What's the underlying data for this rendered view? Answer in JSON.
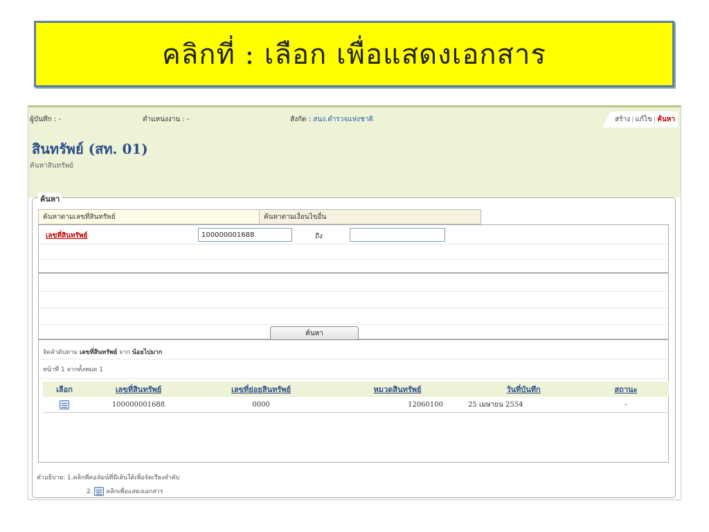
{
  "banner": {
    "text": "คลิกที่ : เลือก เพื่อแสดงเอกสาร"
  },
  "topbar": {
    "recorder": "ผู้บันทึก : -",
    "position": "ตำแหน่งงาน : -",
    "affiliation_label": "สังกัด :",
    "affiliation_value": "สนง.ตำรวจแห่งชาติ",
    "actions": {
      "create": "สร้าง",
      "edit": "แก้ไข",
      "search": "ค้นหา"
    }
  },
  "page": {
    "title": "สินทรัพย์ (สท. 01)",
    "subtitle": "ค้นหาสินทรัพย์"
  },
  "search": {
    "legend": "ค้นหา",
    "tabs": [
      "ค้นหาตามเลขที่สินทรัพย์",
      "ค้นหาตามเงื่อนไขอื่น"
    ],
    "asset_no_label": "เลขที่สินทรัพย์",
    "from_value": "100000001688",
    "to_label": "ถึง",
    "to_value": "",
    "button": "ค้นหา"
  },
  "results": {
    "sort_prefix": "จัดลำดับตาม",
    "sort_field": "เลขที่สินทรัพย์",
    "sort_mid": "จาก",
    "sort_order": "น้อยไปมาก",
    "page_info": "หน้าที่ 1 จากทั้งหมด 1",
    "columns": [
      "เลือก",
      "เลขที่สินทรัพย์",
      "เลขที่ย่อยสินทรัพย์",
      "หมวดสินทรัพย์",
      "วันที่บันทึก",
      "สถานะ"
    ],
    "rows": [
      {
        "asset_no": "100000001688",
        "sub_no": "0000",
        "category": "12060100",
        "date": "25 เมษายน 2554",
        "status": "-"
      }
    ]
  },
  "notes": {
    "line1": "คำอธิบาย: 1.คลิกที่คอลัมน์ที่มีเส้นใต้เพื่อจัดเรียงลำดับ",
    "line2_num": "2.",
    "line2_text": "คลิกเพื่อแสดงเอกสาร"
  },
  "icons": {
    "select_icon": "document-icon"
  },
  "colors": {
    "banner_bg": "#ffff00",
    "header_bg": "#eef3d8",
    "title": "#2d4f86",
    "link_red": "#c00000"
  }
}
